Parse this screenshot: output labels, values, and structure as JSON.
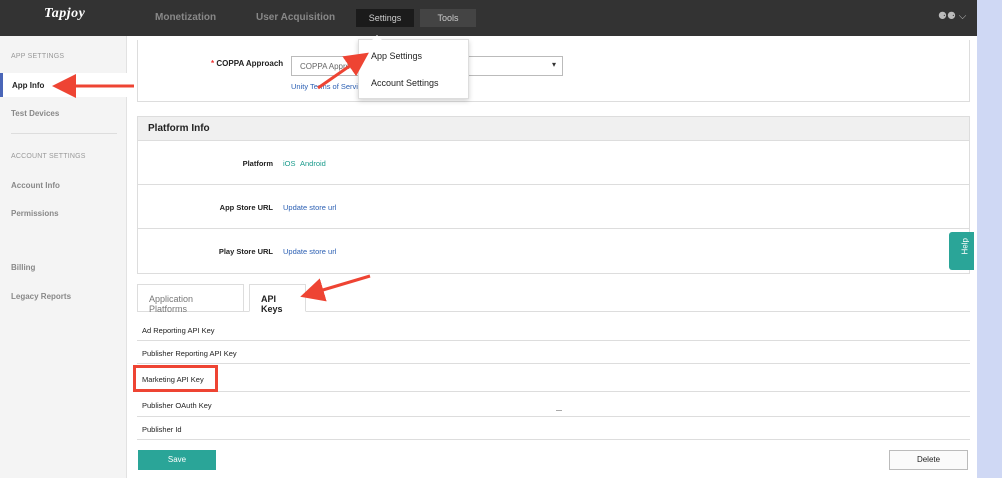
{
  "header": {
    "logo": "Tapjoy",
    "nav": [
      "Monetization",
      "User Acquisition",
      "Settings",
      "Tools"
    ],
    "user_menu": "⚈⚈ ⌵"
  },
  "settings_menu": {
    "items": [
      "App Settings",
      "Account Settings"
    ]
  },
  "sidebar": {
    "app_settings_heading": "APP SETTINGS",
    "app_info": "App Info",
    "test_devices": "Test Devices",
    "account_settings_heading": "ACCOUNT SETTINGS",
    "account_info": "Account Info",
    "permissions": "Permissions",
    "billing": "Billing",
    "legacy_reports": "Legacy Reports"
  },
  "coppa": {
    "label": "COPPA Approach",
    "required_mark": "*",
    "placeholder": "COPPA Approach",
    "caret": "▾",
    "link": "Unity Terms of Service"
  },
  "platform_info": {
    "title": "Platform Info",
    "platform_label": "Platform",
    "platforms": [
      "iOS",
      "Android"
    ],
    "app_store_label": "App Store URL",
    "app_store_link": "Update store url",
    "play_store_label": "Play Store URL",
    "play_store_link": "Update store url"
  },
  "tabs": [
    "Application Platforms",
    "API Keys"
  ],
  "api_keys": [
    "Ad Reporting API Key",
    "Publisher Reporting API Key",
    "Marketing API Key",
    "Publisher OAuth Key",
    "Publisher Id"
  ],
  "buttons": {
    "save": "Save",
    "delete": "Delete"
  },
  "help": "Help",
  "colors": {
    "accent": "#2aa598",
    "annotation": "#e43",
    "link": "#2b5fb3",
    "topbar": "#333333"
  }
}
